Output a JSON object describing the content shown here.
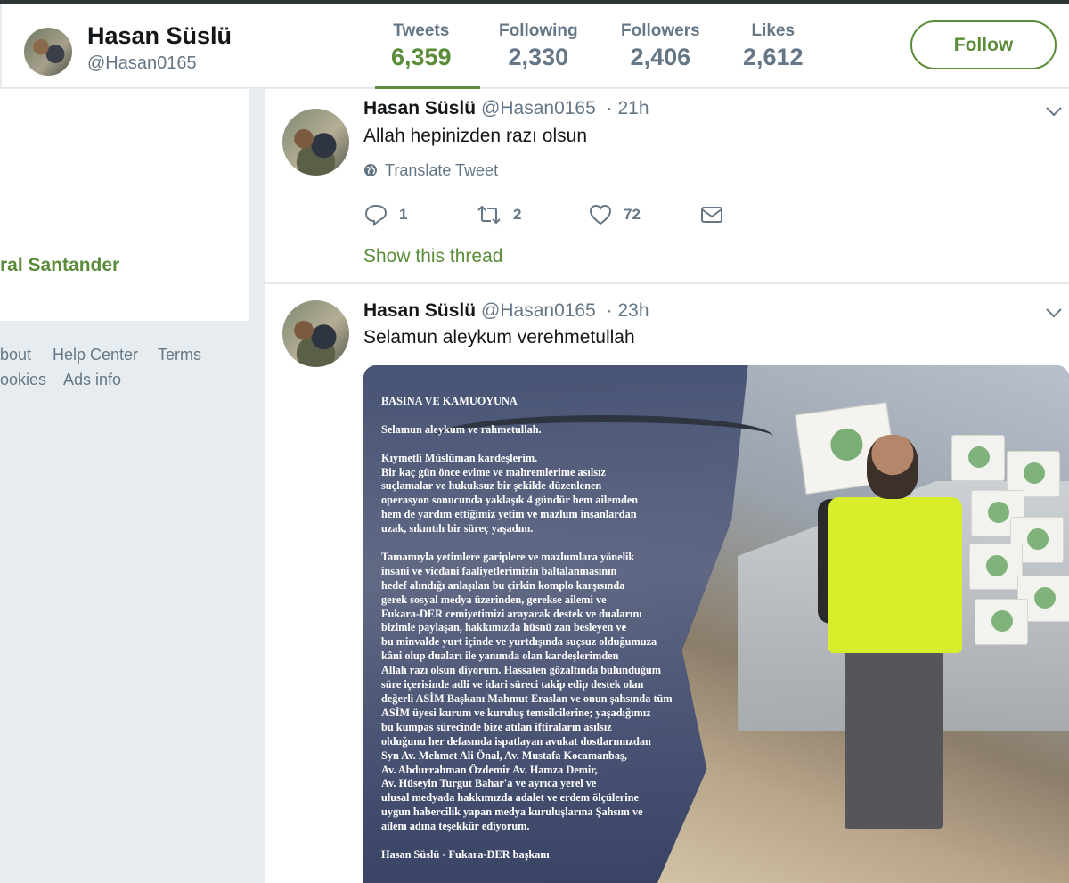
{
  "profile": {
    "name": "Hasan Süslü",
    "handle": "@Hasan0165",
    "follow_label": "Follow"
  },
  "stats": [
    {
      "label": "Tweets",
      "value": "6,359",
      "active": true
    },
    {
      "label": "Following",
      "value": "2,330",
      "active": false
    },
    {
      "label": "Followers",
      "value": "2,406",
      "active": false
    },
    {
      "label": "Likes",
      "value": "2,612",
      "active": false
    }
  ],
  "sidebar": {
    "promo_text": "ral Santander",
    "footer_links": [
      "bout",
      "Help Center",
      "Terms",
      "ookies",
      "Ads info"
    ]
  },
  "tweets": [
    {
      "name": "Hasan Süslü",
      "handle": "@Hasan0165",
      "time": "· 21h",
      "text": "Allah hepinizden razı olsun",
      "translate": "Translate Tweet",
      "replies": "1",
      "retweets": "2",
      "likes": "72",
      "thread_link": "Show this thread"
    },
    {
      "name": "Hasan Süslü",
      "handle": "@Hasan0165",
      "time": "· 23h",
      "text": "Selamun aleykum verehmetullah",
      "image_letter": [
        "BASINA VE KAMUOYUNA",
        "Selamun aleykum ve rahmetullah.",
        "Kıymetli Müslüman kardeşlerim.\nBir kaç gün önce  evime ve mahremlerime asılsız\nsuçlamalar ve hukuksuz bir şekilde düzenlenen\noperasyon sonucunda yaklaşık 4 gündür hem ailemden\nhem de yardım ettiğimiz yetim ve mazlum insanlardan\nuzak, sıkıntılı bir süreç yaşadım.",
        "Tamamıyla yetimlere gariplere ve mazlumlara yönelik\ninsani ve vicdani faaliyetlerimizin baltalanmasının\nhedef alındığı anlaşılan bu çirkin komplo karşısında\ngerek sosyal medya üzerinden, gerekse ailemi ve\nFukara-DER cemiyetimizi arayarak destek ve dualarını\nbizimle paylaşan, hakkımızda hüsnü zan besleyen ve\nbu minvalde yurt içinde ve yurtdışında suçsuz olduğumuza\nkâni olup duaları ile yanımda olan kardeşlerimden\nAllah razı olsun diyorum. Hassaten gözaltında bulunduğum\nsüre içerisinde adli ve idari süreci takip edip destek olan\ndeğerli ASİM Başkanı Mahmut Eraslan ve onun şahsında tüm\nASİM üyesi kurum ve kuruluş temsilcilerine;  yaşadığımız\nbu kumpas sürecinde bize atılan iftiraların asılsız\nolduğunu her defasında ispatlayan avukat dostlarımızdan\nSyn Av. Mehmet Ali Önal, Av. Mustafa Kocamanbaş,\nAv. Abdurrahman Özdemir Av. Hamza Demir,\nAv. Hüseyin Turgut Bahar'a ve ayrıca yerel ve\nulusal medyada hakkımızda adalet ve erdem ölçülerine\nuygun habercilik yapan medya kuruluşlarına Şahsım ve\nailem adına teşekkür ediyorum.",
        "Hasan Süslü - Fukara-DER başkanı"
      ]
    }
  ],
  "colors": {
    "accent": "#5b8c3a",
    "secondary_text": "#657786",
    "background": "#e6ecf0"
  },
  "icons": [
    "reply-icon",
    "retweet-icon",
    "like-icon",
    "message-icon",
    "globe-icon",
    "chevron-down-icon"
  ]
}
